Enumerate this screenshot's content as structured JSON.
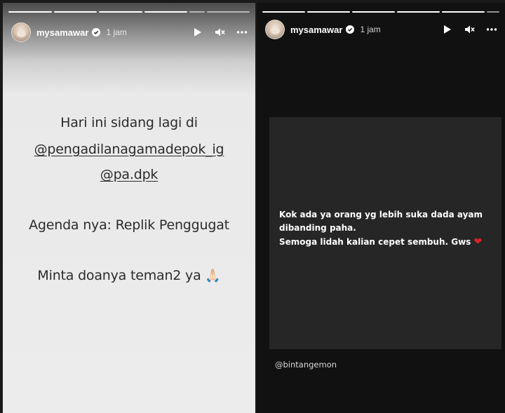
{
  "left_story": {
    "username": "mysamawar",
    "time": "1 jam",
    "lines": [
      "Hari ini sidang lagi di",
      "@pengadilanagamadepok_ig",
      "@pa.dpk",
      "Agenda nya: Replik Penggugat",
      "Minta doanya teman2 ya"
    ],
    "emoji": "🙏🏻"
  },
  "right_story": {
    "username": "mysamawar",
    "time": "1 jam",
    "quote_lines": [
      "Kok ada ya orang yg lebih suka dada ayam",
      "dibanding paha.",
      "Semoga lidah kalian cepet sembuh. Gws"
    ],
    "heart": "❤",
    "credit": "@bintangemon"
  },
  "icons": {
    "play": "play-icon",
    "mute": "mute-icon",
    "more": "more-icon",
    "verified": "verified-badge-icon"
  },
  "colors": {
    "left_bg": "#ececec",
    "right_bg": "#111111",
    "card_bg": "#262626",
    "heart": "#e0202a"
  }
}
